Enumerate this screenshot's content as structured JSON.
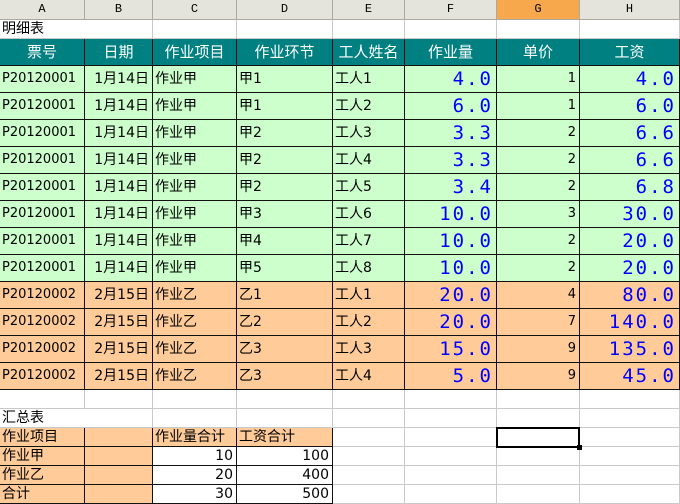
{
  "columns": [
    "A",
    "B",
    "C",
    "D",
    "E",
    "F",
    "G",
    "H"
  ],
  "active_column": "G",
  "detail_title": "明细表",
  "detail_headers": [
    "票号",
    "日期",
    "作业项目",
    "作业环节",
    "工人姓名",
    "作业量",
    "单价",
    "工资"
  ],
  "detail_rows": [
    {
      "ticket": "P20120001",
      "date": "1月14日",
      "item": "作业甲",
      "step": "甲1",
      "worker": "工人1",
      "qty": "4.0",
      "price": "1",
      "wage": "4.0",
      "group": "甲"
    },
    {
      "ticket": "P20120001",
      "date": "1月14日",
      "item": "作业甲",
      "step": "甲1",
      "worker": "工人2",
      "qty": "6.0",
      "price": "1",
      "wage": "6.0",
      "group": "甲"
    },
    {
      "ticket": "P20120001",
      "date": "1月14日",
      "item": "作业甲",
      "step": "甲2",
      "worker": "工人3",
      "qty": "3.3",
      "price": "2",
      "wage": "6.6",
      "group": "甲"
    },
    {
      "ticket": "P20120001",
      "date": "1月14日",
      "item": "作业甲",
      "step": "甲2",
      "worker": "工人4",
      "qty": "3.3",
      "price": "2",
      "wage": "6.6",
      "group": "甲"
    },
    {
      "ticket": "P20120001",
      "date": "1月14日",
      "item": "作业甲",
      "step": "甲2",
      "worker": "工人5",
      "qty": "3.4",
      "price": "2",
      "wage": "6.8",
      "group": "甲"
    },
    {
      "ticket": "P20120001",
      "date": "1月14日",
      "item": "作业甲",
      "step": "甲3",
      "worker": "工人6",
      "qty": "10.0",
      "price": "3",
      "wage": "30.0",
      "group": "甲"
    },
    {
      "ticket": "P20120001",
      "date": "1月14日",
      "item": "作业甲",
      "step": "甲4",
      "worker": "工人7",
      "qty": "10.0",
      "price": "2",
      "wage": "20.0",
      "group": "甲"
    },
    {
      "ticket": "P20120001",
      "date": "1月14日",
      "item": "作业甲",
      "step": "甲5",
      "worker": "工人8",
      "qty": "10.0",
      "price": "2",
      "wage": "20.0",
      "group": "甲"
    },
    {
      "ticket": "P20120002",
      "date": "2月15日",
      "item": "作业乙",
      "step": "乙1",
      "worker": "工人1",
      "qty": "20.0",
      "price": "4",
      "wage": "80.0",
      "group": "乙"
    },
    {
      "ticket": "P20120002",
      "date": "2月15日",
      "item": "作业乙",
      "step": "乙2",
      "worker": "工人2",
      "qty": "20.0",
      "price": "7",
      "wage": "140.0",
      "group": "乙"
    },
    {
      "ticket": "P20120002",
      "date": "2月15日",
      "item": "作业乙",
      "step": "乙3",
      "worker": "工人3",
      "qty": "15.0",
      "price": "9",
      "wage": "135.0",
      "group": "乙"
    },
    {
      "ticket": "P20120002",
      "date": "2月15日",
      "item": "作业乙",
      "step": "乙3",
      "worker": "工人4",
      "qty": "5.0",
      "price": "9",
      "wage": "45.0",
      "group": "乙"
    }
  ],
  "summary_title": "汇总表",
  "summary_headers": [
    "作业项目",
    "",
    "作业量合计",
    "工资合计"
  ],
  "summary_rows": [
    {
      "item": "作业甲",
      "qty_total": "10",
      "wage_total": "100"
    },
    {
      "item": "作业乙",
      "qty_total": "20",
      "wage_total": "400"
    },
    {
      "item": "合计",
      "qty_total": "30",
      "wage_total": "500"
    }
  ],
  "colors": {
    "header_teal": "#008080",
    "group_jia_green": "#ccffcc",
    "group_yi_orange": "#ffcc99",
    "value_blue": "#0000ff",
    "active_column_orange": "#f7a84c"
  }
}
